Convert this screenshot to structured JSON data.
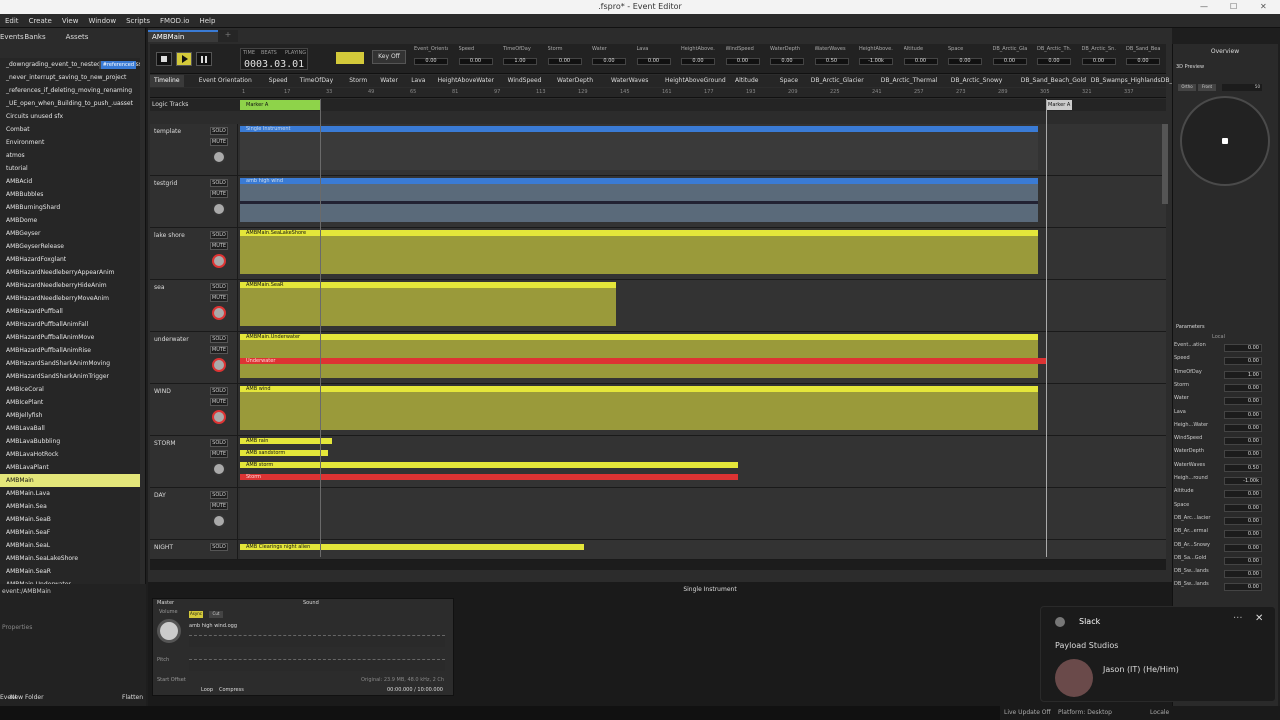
{
  "window": {
    "title": ".fspro* - Event Editor"
  },
  "menu": [
    "Edit",
    "Create",
    "View",
    "Window",
    "Scripts",
    "FMOD.io",
    "Help"
  ],
  "left": {
    "tabs": [
      "Events",
      "Banks",
      "Assets"
    ],
    "items": [
      {
        "label": "_downgrading_event_to_nested_leaves_.uasset",
        "tag": ""
      },
      {
        "label": "_never_interrupt_saving_to_new_project",
        "tag": ""
      },
      {
        "label": "_references_if_deleting_moving_renaming",
        "tag": ""
      },
      {
        "label": "_UE_open_when_Building_to_push_.uasset",
        "tag": ""
      },
      {
        "label": "Circuits unused sfx",
        "tag": ""
      },
      {
        "label": "Combat",
        "tag": ""
      },
      {
        "label": "Environment",
        "tag": ""
      },
      {
        "label": "atmos",
        "tag": ""
      },
      {
        "label": "tutorial",
        "tag": ""
      },
      {
        "label": "AMBAcid",
        "tag": ""
      },
      {
        "label": "AMBBubbles",
        "tag": ""
      },
      {
        "label": "AMBBurningShard",
        "tag": ""
      },
      {
        "label": "AMBDome",
        "tag": "#unassigned"
      },
      {
        "label": "AMBGeyser",
        "tag": ""
      },
      {
        "label": "AMBGeyserRelease",
        "tag": ""
      },
      {
        "label": "AMBHazardFoxglant",
        "tag": ""
      },
      {
        "label": "AMBHazardNeedleberryAppearAnim",
        "tag": ""
      },
      {
        "label": "AMBHazardNeedleberryHideAnim",
        "tag": ""
      },
      {
        "label": "AMBHazardNeedleberryMoveAnim",
        "tag": ""
      },
      {
        "label": "AMBHazardPuffball",
        "tag": ""
      },
      {
        "label": "AMBHazardPuffballAnimFall",
        "tag": ""
      },
      {
        "label": "AMBHazardPuffballAnimMove",
        "tag": ""
      },
      {
        "label": "AMBHazardPuffballAnimRise",
        "tag": ""
      },
      {
        "label": "AMBHazardSandSharkAnimMoving",
        "tag": ""
      },
      {
        "label": "AMBHazardSandSharkAnimTrigger",
        "tag": ""
      },
      {
        "label": "AMBIceCoral",
        "tag": ""
      },
      {
        "label": "AMBIcePlant",
        "tag": ""
      },
      {
        "label": "AMBJellyfish",
        "tag": "#unassigned"
      },
      {
        "label": "AMBLavaBall",
        "tag": ""
      },
      {
        "label": "AMBLavaBubbling",
        "tag": ""
      },
      {
        "label": "AMBLavaHotRock",
        "tag": ""
      },
      {
        "label": "AMBLavaPlant",
        "tag": ""
      },
      {
        "label": "AMBMain",
        "tag": "",
        "selected": true
      },
      {
        "label": "AMBMain.Lava",
        "tag": "#referenced"
      },
      {
        "label": "AMBMain.Sea",
        "tag": "#referenced"
      },
      {
        "label": "AMBMain.SeaB",
        "tag": "#referenced"
      },
      {
        "label": "AMBMain.SeaF",
        "tag": "#referenced"
      },
      {
        "label": "AMBMain.SeaL",
        "tag": "#referenced"
      },
      {
        "label": "AMBMain.SeaLakeShore",
        "tag": "#referenced"
      },
      {
        "label": "AMBMain.SeaR",
        "tag": "#referenced"
      },
      {
        "label": "AMBMain.Underwater",
        "tag": "#referenced"
      }
    ],
    "path": "event:/AMBMain",
    "properties": "Properties",
    "bottom_buttons": [
      "Event",
      "New Folder",
      "Flatten"
    ]
  },
  "editor": {
    "tab": "AMBMain",
    "time": "0003.03.01",
    "time_labels": [
      "TIME",
      "BEATS",
      "PLAYING"
    ],
    "key_off": "Key Off",
    "params": [
      {
        "name": "Event_Orienta...",
        "val": "0.00"
      },
      {
        "name": "Speed",
        "val": "0.00"
      },
      {
        "name": "TimeOfDay",
        "val": "1.00"
      },
      {
        "name": "Storm",
        "val": "0.00"
      },
      {
        "name": "Water",
        "val": "0.00"
      },
      {
        "name": "Lava",
        "val": "0.00"
      },
      {
        "name": "HeightAbove...",
        "val": "0.00"
      },
      {
        "name": "WindSpeed",
        "val": "0.00"
      },
      {
        "name": "WaterDepth",
        "val": "0.00"
      },
      {
        "name": "WaterWaves",
        "val": "0.50"
      },
      {
        "name": "HeightAbove...",
        "val": "-1.00k"
      },
      {
        "name": "Altitude",
        "val": "0.00"
      },
      {
        "name": "Space",
        "val": "0.00"
      },
      {
        "name": "DB_Arctic_Gla...",
        "val": "0.00"
      },
      {
        "name": "DB_Arctic_Th...",
        "val": "0.00"
      },
      {
        "name": "DB_Arctic_Sn...",
        "val": "0.00"
      },
      {
        "name": "DB_Sand_Bea...",
        "val": "0.00"
      }
    ],
    "param_tabs": [
      "Timeline",
      "Event Orientation",
      "Speed",
      "TimeOfDay",
      "Storm",
      "Water",
      "Lava",
      "HeightAboveWater",
      "WindSpeed",
      "WaterDepth",
      "WaterWaves",
      "HeightAboveGround",
      "Altitude",
      "Space",
      "DB_Arctic_Glacier",
      "DB_Arctic_Thermal",
      "DB_Arctic_Snowy",
      "DB_Sand_Beach_Gold",
      "DB_Swamps_Highlands",
      "DB_Swamps_Lo"
    ],
    "ruler": [
      "1",
      "17",
      "33",
      "49",
      "65",
      "81",
      "97",
      "113",
      "129",
      "145",
      "161",
      "177",
      "193",
      "209",
      "225",
      "241",
      "257",
      "273",
      "289",
      "305",
      "321",
      "337"
    ],
    "logic_tracks": "Logic Tracks",
    "marker_a": "Marker A",
    "marker_b": "Marker A",
    "solo": "SOLO",
    "mute": "MUTE",
    "tracks": [
      {
        "name": "template",
        "instruments": [
          {
            "label": "Single Instrument",
            "color": "blue"
          }
        ]
      },
      {
        "name": "testgrid",
        "instruments": [
          {
            "label": "amb high wind",
            "color": "blue"
          }
        ]
      },
      {
        "name": "lake shore",
        "instruments": [
          {
            "label": "AMBMain.SeaLakeShore",
            "color": "yellow"
          }
        ]
      },
      {
        "name": "sea",
        "instruments": [
          {
            "label": "AMBMain.SeaR",
            "color": "yellow"
          }
        ]
      },
      {
        "name": "underwater",
        "instruments": [
          {
            "label": "AMBMain.Underwater",
            "color": "yellow"
          },
          {
            "label": "Underwater",
            "color": "red"
          }
        ]
      },
      {
        "name": "WIND",
        "instruments": [
          {
            "label": "AMB wind",
            "color": "yellow"
          }
        ]
      },
      {
        "name": "STORM",
        "instruments": [
          {
            "label": "AMB rain",
            "color": "yellow"
          },
          {
            "label": "AMB sandstorm",
            "color": "yellow"
          },
          {
            "label": "AMB storm",
            "color": "yellow"
          },
          {
            "label": "Storm",
            "color": "red"
          }
        ]
      },
      {
        "name": "DAY",
        "instruments": []
      },
      {
        "name": "NIGHT",
        "instruments": [
          {
            "label": "AMB Clearings night alien",
            "color": "yellow"
          }
        ]
      }
    ]
  },
  "deck": {
    "title": "Single Instrument",
    "master": "Master",
    "sound": "Sound",
    "volume": "Volume",
    "async": "Async",
    "cut": "Cut",
    "file": "amb high wind.ogg",
    "pitch": "Pitch",
    "start_offset": "Start Offset",
    "loop": "Loop",
    "compress": "Compress",
    "original": "Original: 23.9 MB, 48.0 kHz, 2 Ch",
    "time": "00:00.000 / 10:00.000",
    "trigger": "Trigger Behavior"
  },
  "right": {
    "overview": "Overview",
    "preview": "3D Preview",
    "view_labels": [
      "View",
      "Radius"
    ],
    "view_btns": [
      "Ortho",
      "Front"
    ],
    "radius_val": "50",
    "parameters": "Parameters",
    "local": "Local",
    "params": [
      {
        "name": "Event...ation",
        "val": "0.00"
      },
      {
        "name": "Speed",
        "val": "0.00"
      },
      {
        "name": "TimeOfDay",
        "val": "1.00"
      },
      {
        "name": "Storm",
        "val": "0.00"
      },
      {
        "name": "Water",
        "val": "0.00"
      },
      {
        "name": "Lava",
        "val": "0.00"
      },
      {
        "name": "Heigh...Water",
        "val": "0.00"
      },
      {
        "name": "WindSpeed",
        "val": "0.00"
      },
      {
        "name": "WaterDepth",
        "val": "0.00"
      },
      {
        "name": "WaterWaves",
        "val": "0.50"
      },
      {
        "name": "Heigh...round",
        "val": "-1.00k"
      },
      {
        "name": "Altitude",
        "val": "0.00"
      },
      {
        "name": "Space",
        "val": "0.00"
      },
      {
        "name": "DB_Arc...lacier",
        "val": "0.00"
      },
      {
        "name": "DB_Ar...ermal",
        "val": "0.00"
      },
      {
        "name": "DB_Ar...Snowy",
        "val": "0.00"
      },
      {
        "name": "DB_Sa...Gold",
        "val": "0.00"
      },
      {
        "name": "DB_Sw...lands",
        "val": "0.00"
      },
      {
        "name": "DB_Sw...lands",
        "val": "0.00"
      }
    ]
  },
  "slack": {
    "app": "Slack",
    "workspace": "Payload Studios",
    "user": "Jason (IT) (He/Him)"
  },
  "status": [
    "Live Update Off",
    "Platform: Desktop",
    "Locale"
  ]
}
